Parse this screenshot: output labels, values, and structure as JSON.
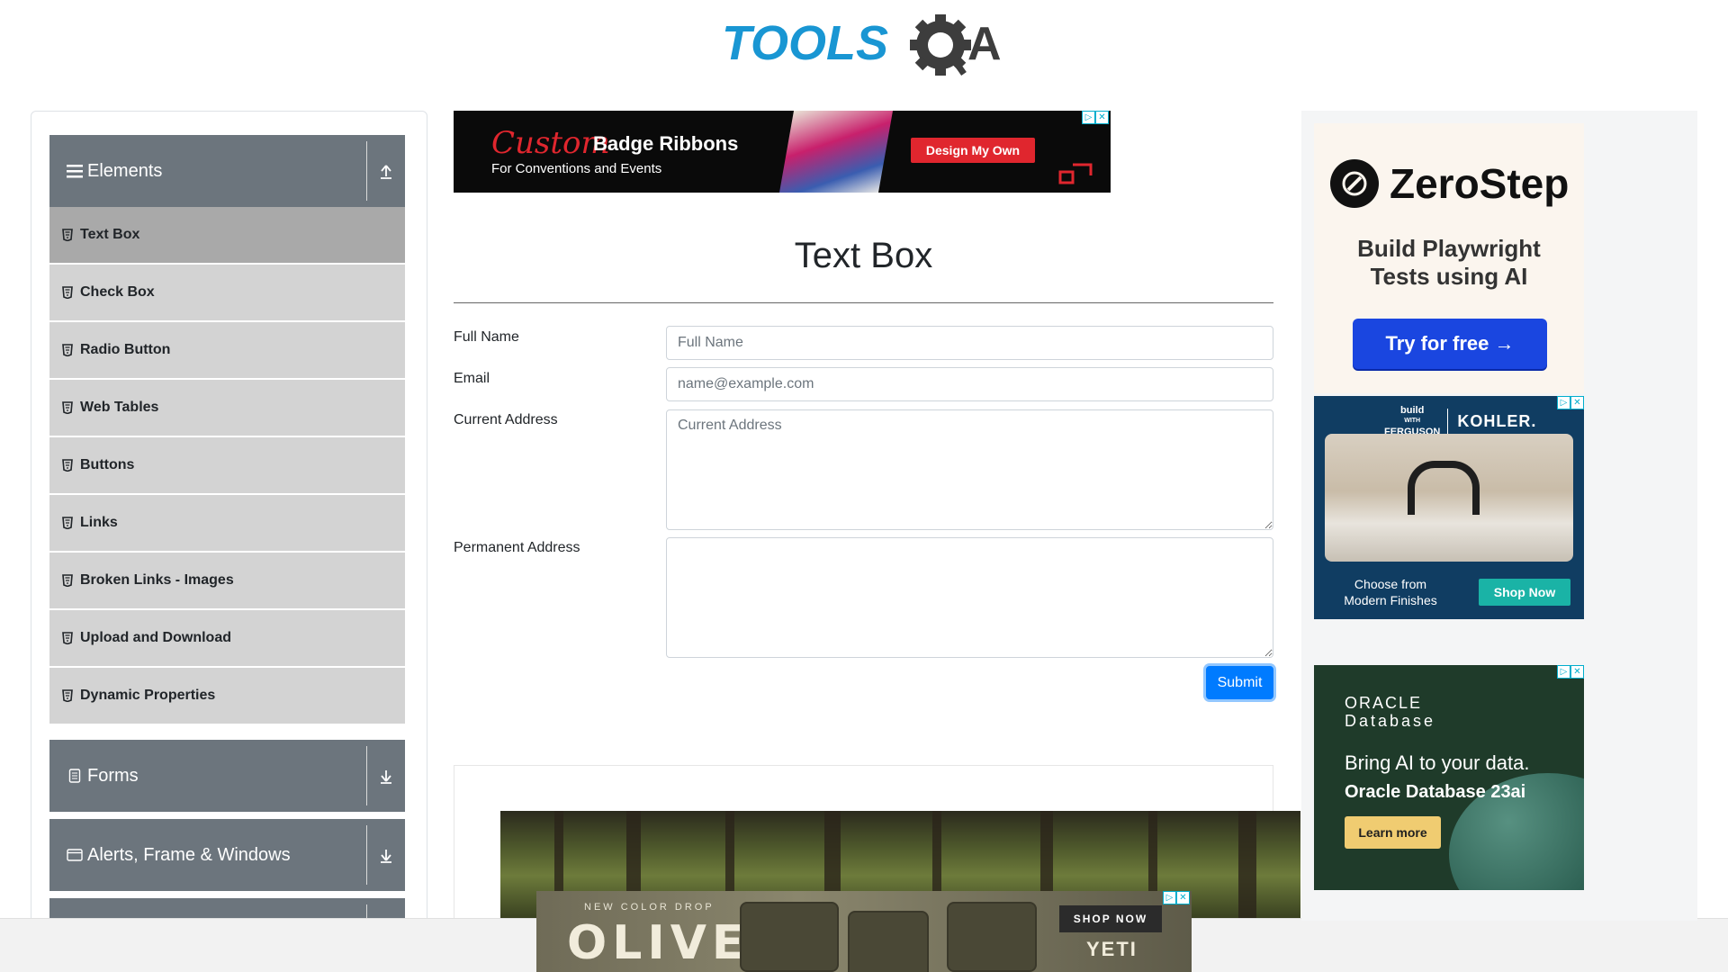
{
  "logo": {
    "text_tools": "TOOLS",
    "text_qa": "QA",
    "alt": "TOOLSQA"
  },
  "sidebar": {
    "groups": [
      {
        "title": "Elements",
        "icon": "hamburger-icon",
        "toggle": "collapse-arrow-up-icon",
        "expanded": true
      },
      {
        "title": "Forms",
        "icon": "document-icon",
        "toggle": "expand-arrow-down-icon",
        "expanded": false
      },
      {
        "title": "Alerts, Frame & Windows",
        "icon": "window-icon",
        "toggle": "expand-arrow-down-icon",
        "expanded": false
      }
    ],
    "items": [
      {
        "label": "Text Box",
        "active": true
      },
      {
        "label": "Check Box",
        "active": false
      },
      {
        "label": "Radio Button",
        "active": false
      },
      {
        "label": "Web Tables",
        "active": false
      },
      {
        "label": "Buttons",
        "active": false
      },
      {
        "label": "Links",
        "active": false
      },
      {
        "label": "Broken Links - Images",
        "active": false
      },
      {
        "label": "Upload and Download",
        "active": false
      },
      {
        "label": "Dynamic Properties",
        "active": false
      }
    ]
  },
  "main": {
    "title": "Text Box",
    "form": {
      "full_name": {
        "label": "Full Name",
        "placeholder": "Full Name",
        "value": ""
      },
      "email": {
        "label": "Email",
        "placeholder": "name@example.com",
        "value": ""
      },
      "current_address": {
        "label": "Current Address",
        "placeholder": "Current Address",
        "value": ""
      },
      "permanent_address": {
        "label": "Permanent Address",
        "placeholder": "",
        "value": ""
      },
      "submit_label": "Submit"
    }
  },
  "ads": {
    "top_banner": {
      "script": "Custom",
      "headline": "Badge Ribbons",
      "sub": "For Conventions and Events",
      "cta": "Design My Own"
    },
    "zerostep": {
      "brand": "ZeroStep",
      "tag_line1": "Build Playwright",
      "tag_line2": "Tests using AI",
      "cta": "Try for free →"
    },
    "kohler": {
      "bwf_top": "build",
      "bwf_mid": "WITH",
      "bwf_bottom": "FERGUSON",
      "brand": "KOHLER.",
      "copy_line1": "Choose from",
      "copy_line2": "Modern Finishes",
      "cta": "Shop Now"
    },
    "oracle": {
      "brand_line1": "ORACLE",
      "brand_line2": "Database",
      "line1": "Bring AI to your data.",
      "line2": "Oracle Database 23ai",
      "cta": "Learn more"
    },
    "yeti": {
      "kicker": "NEW COLOR DROP",
      "big": "OLIVE",
      "cta": "SHOP NOW",
      "brand": "YETI"
    }
  },
  "colors": {
    "accent": "#007bff",
    "sidebar_header": "#6c757d",
    "menu_item": "#d3d3d3",
    "menu_active": "#a9a9a9",
    "logo_blue": "#1996d3",
    "logo_dark": "#3d3d3d"
  }
}
